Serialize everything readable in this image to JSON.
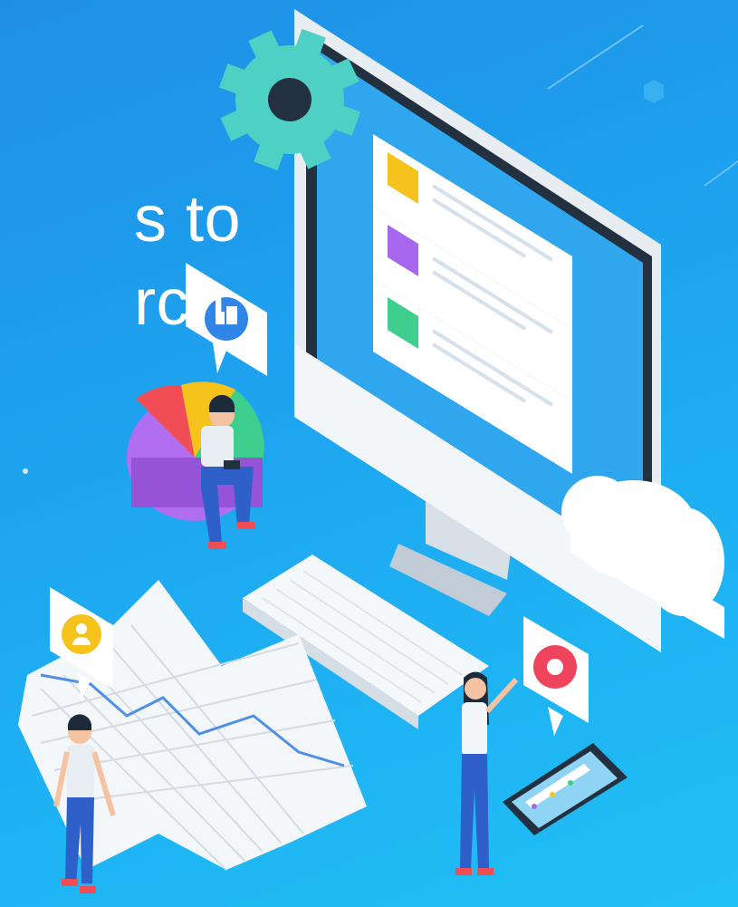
{
  "headline": {
    "line1": "s to",
    "line2": "rch"
  },
  "colors": {
    "background_top": "#1f8fe6",
    "background_bottom": "#20c0f5",
    "text": "#ffffff",
    "gear": "#4fd0c4",
    "card_yellow": "#f6c21c",
    "card_purple": "#a867ef",
    "card_green": "#3ecf8e",
    "alert_red": "#f0445d",
    "cloud": "#ffffff"
  },
  "icons": [
    "gear-icon",
    "thumbs-up-icon",
    "user-icon",
    "record-icon",
    "cloud-icon"
  ]
}
